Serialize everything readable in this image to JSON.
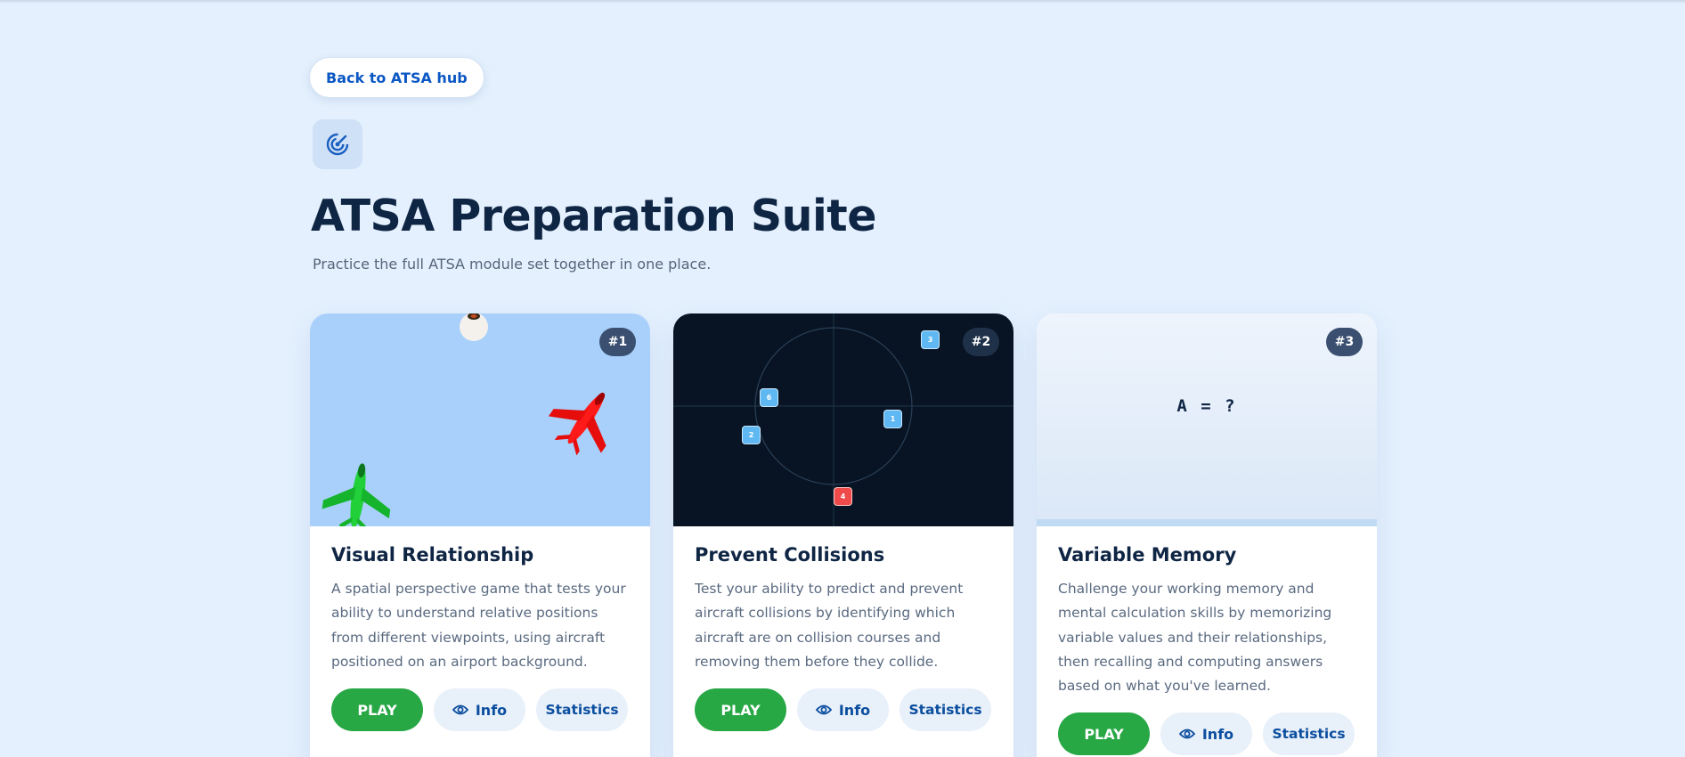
{
  "nav": {
    "back_label": "Back to ATSA hub"
  },
  "header": {
    "title": "ATSA Preparation Suite",
    "subtitle": "Practice the full ATSA module set together in one place."
  },
  "cards": [
    {
      "rank": "#1",
      "title": "Visual Relationship",
      "description": "A spatial perspective game that tests your ability to understand relative positions from different viewpoints, using aircraft positioned on an airport background.",
      "play_label": "PLAY",
      "info_label": "Info",
      "stats_label": "Statistics"
    },
    {
      "rank": "#2",
      "title": "Prevent Collisions",
      "description": "Test your ability to predict and prevent aircraft collisions by identifying which aircraft are on collision courses and removing them before they collide.",
      "play_label": "PLAY",
      "info_label": "Info",
      "stats_label": "Statistics",
      "radar_tags": [
        "3",
        "6",
        "1",
        "2",
        "4"
      ]
    },
    {
      "rank": "#3",
      "title": "Variable Memory",
      "description": "Challenge your working memory and mental calculation skills by memorizing variable values and their relationships, then recalling and computing answers based on what you've learned.",
      "play_label": "PLAY",
      "info_label": "Info",
      "stats_label": "Statistics",
      "preview_text": "A = ?"
    }
  ],
  "colors": {
    "page_bg": "#e4f0fd",
    "play": "#28a745",
    "link": "#0b57c4",
    "badge": "#3b5070",
    "radar_bg": "#081423",
    "sky_bg": "#a8d0fb"
  },
  "icons": {
    "logo": "radar-icon",
    "info": "eye-icon",
    "planes": [
      "green-airplane",
      "red-airplane"
    ]
  }
}
